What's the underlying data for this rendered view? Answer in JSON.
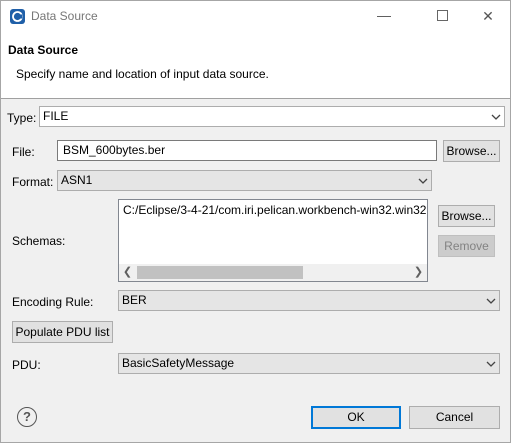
{
  "window": {
    "title": "Data Source",
    "minimize_glyph": "—",
    "close_glyph": "✕"
  },
  "header": {
    "title": "Data Source",
    "description": "Specify name and location of input data source."
  },
  "form": {
    "type_label": "Type:",
    "type_value": "FILE",
    "file_label": "File:",
    "file_value": "BSM_600bytes.ber",
    "file_browse_label": "Browse...",
    "format_label": "Format:",
    "format_value": "ASN1",
    "schemas_label": "Schemas:",
    "schemas_items": [
      "C:/Eclipse/3-4-21/com.iri.pelican.workbench-win32.win32"
    ],
    "schemas_browse_label": "Browse...",
    "schemas_remove_label": "Remove",
    "encoding_label": "Encoding Rule:",
    "encoding_value": "BER",
    "populate_label": "Populate PDU list",
    "pdu_label": "PDU:",
    "pdu_value": "BasicSafetyMessage"
  },
  "footer": {
    "help_glyph": "?",
    "ok_label": "OK",
    "cancel_label": "Cancel"
  },
  "icons": {
    "app": "eclipse-icon",
    "dropdown": "chevron-down-icon",
    "scroll_left": "scroll-left-icon",
    "scroll_right": "scroll-right-icon",
    "help": "help-icon"
  },
  "colors": {
    "default_button_border": "#0078d7",
    "app_icon": "#1f5fa8"
  }
}
